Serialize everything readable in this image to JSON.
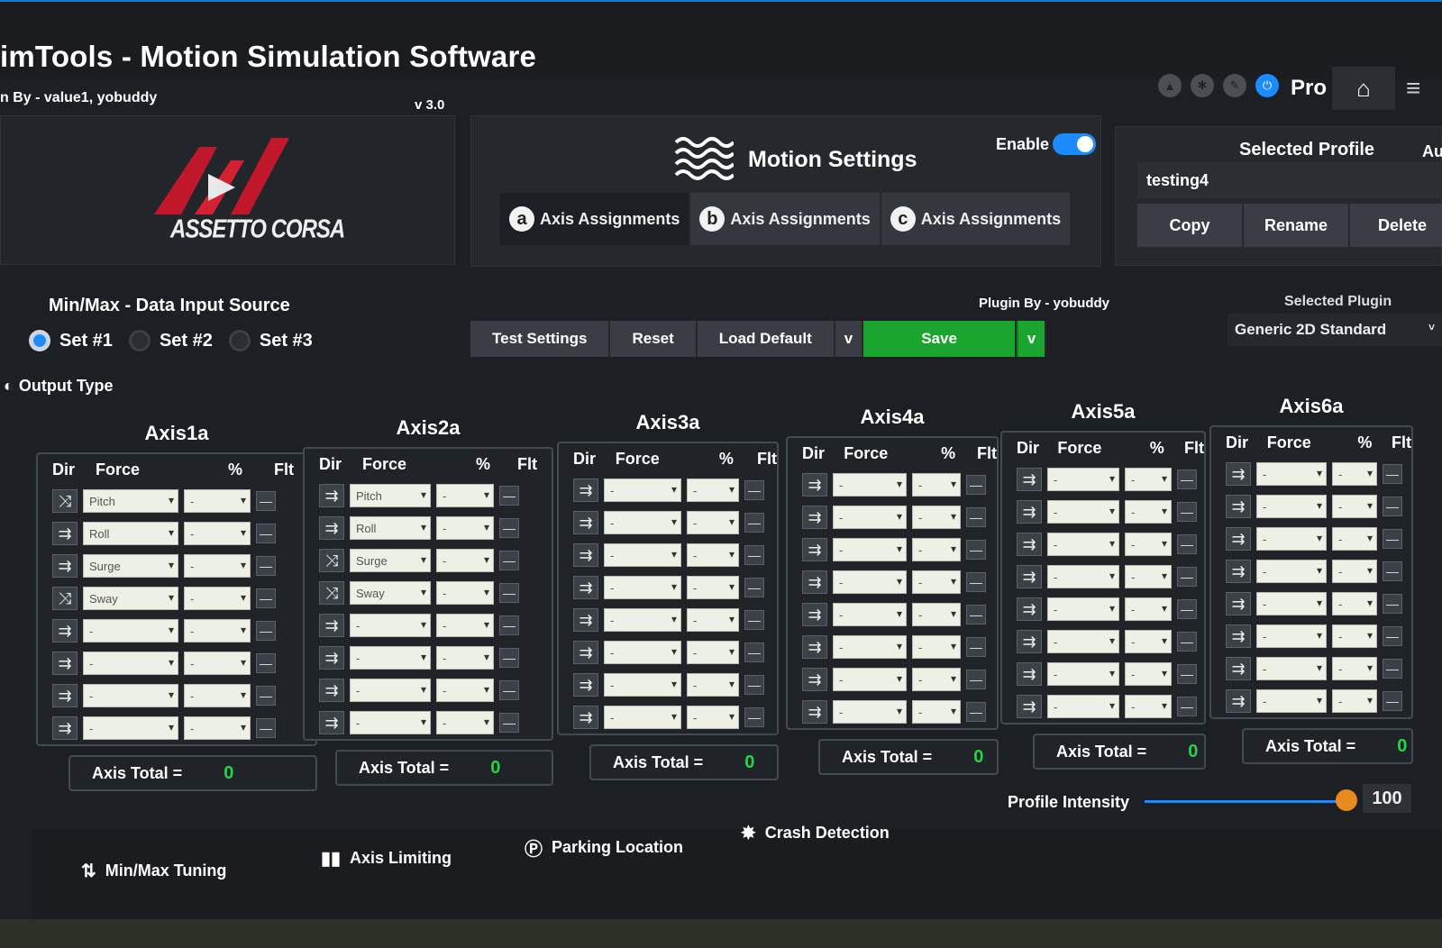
{
  "app": {
    "title": "imTools - Motion Simulation Software",
    "credits": "n By - value1, yobuddy",
    "version": "v 3.0",
    "edition": "Pro",
    "logo_text": "ASSETTO CORSA"
  },
  "motion": {
    "title": "Motion Settings",
    "enable_label": "Enable",
    "enable_on": true,
    "tabs": [
      {
        "badge": "a",
        "label": "Axis Assignments"
      },
      {
        "badge": "b",
        "label": "Axis Assignments"
      },
      {
        "badge": "c",
        "label": "Axis Assignments"
      }
    ]
  },
  "profile": {
    "label": "Selected Profile",
    "auto_label": "Au",
    "value": "testing4",
    "buttons": [
      "Copy",
      "Rename",
      "Delete"
    ]
  },
  "input_source": {
    "label": "Min/Max - Data Input Source",
    "options": [
      "Set #1",
      "Set #2",
      "Set #3"
    ],
    "selected": "Set #1"
  },
  "output_type_label": "Output Type",
  "actions": {
    "test": "Test Settings",
    "reset": "Reset",
    "load_default": "Load Default",
    "dropdown": "v",
    "save": "Save"
  },
  "plugin": {
    "by": "Plugin By - yobuddy",
    "label": "Selected Plugin",
    "value": "Generic 2D Standard"
  },
  "table_headers": {
    "dir": "Dir",
    "force": "Force",
    "pct": "%",
    "flt": "Flt"
  },
  "total_label": "Axis Total =",
  "axes": [
    {
      "name": "Axis1a",
      "total": "0",
      "rows": [
        {
          "dir": "swap",
          "force": "Pitch",
          "pct": "-"
        },
        {
          "dir": "arrow",
          "force": "Roll",
          "pct": "-"
        },
        {
          "dir": "arrow",
          "force": "Surge",
          "pct": "-"
        },
        {
          "dir": "swap",
          "force": "Sway",
          "pct": "-"
        },
        {
          "dir": "arrow",
          "force": "-",
          "pct": "-"
        },
        {
          "dir": "arrow",
          "force": "-",
          "pct": "-"
        },
        {
          "dir": "arrow",
          "force": "-",
          "pct": "-"
        },
        {
          "dir": "arrow",
          "force": "-",
          "pct": "-"
        }
      ]
    },
    {
      "name": "Axis2a",
      "total": "0",
      "rows": [
        {
          "dir": "arrow",
          "force": "Pitch",
          "pct": "-"
        },
        {
          "dir": "arrow",
          "force": "Roll",
          "pct": "-"
        },
        {
          "dir": "swap",
          "force": "Surge",
          "pct": "-"
        },
        {
          "dir": "swap",
          "force": "Sway",
          "pct": "-"
        },
        {
          "dir": "arrow",
          "force": "-",
          "pct": "-"
        },
        {
          "dir": "arrow",
          "force": "-",
          "pct": "-"
        },
        {
          "dir": "arrow",
          "force": "-",
          "pct": "-"
        },
        {
          "dir": "arrow",
          "force": "-",
          "pct": "-"
        }
      ]
    },
    {
      "name": "Axis3a",
      "total": "0",
      "rows": [
        {
          "dir": "arrow",
          "force": "-",
          "pct": "-"
        },
        {
          "dir": "arrow",
          "force": "-",
          "pct": "-"
        },
        {
          "dir": "arrow",
          "force": "-",
          "pct": "-"
        },
        {
          "dir": "arrow",
          "force": "-",
          "pct": "-"
        },
        {
          "dir": "arrow",
          "force": "-",
          "pct": "-"
        },
        {
          "dir": "arrow",
          "force": "-",
          "pct": "-"
        },
        {
          "dir": "arrow",
          "force": "-",
          "pct": "-"
        },
        {
          "dir": "arrow",
          "force": "-",
          "pct": "-"
        }
      ]
    },
    {
      "name": "Axis4a",
      "total": "0",
      "rows": [
        {
          "dir": "arrow",
          "force": "-",
          "pct": "-"
        },
        {
          "dir": "arrow",
          "force": "-",
          "pct": "-"
        },
        {
          "dir": "arrow",
          "force": "-",
          "pct": "-"
        },
        {
          "dir": "arrow",
          "force": "-",
          "pct": "-"
        },
        {
          "dir": "arrow",
          "force": "-",
          "pct": "-"
        },
        {
          "dir": "arrow",
          "force": "-",
          "pct": "-"
        },
        {
          "dir": "arrow",
          "force": "-",
          "pct": "-"
        },
        {
          "dir": "arrow",
          "force": "-",
          "pct": "-"
        }
      ]
    },
    {
      "name": "Axis5a",
      "total": "0",
      "rows": [
        {
          "dir": "arrow",
          "force": "-",
          "pct": "-"
        },
        {
          "dir": "arrow",
          "force": "-",
          "pct": "-"
        },
        {
          "dir": "arrow",
          "force": "-",
          "pct": "-"
        },
        {
          "dir": "arrow",
          "force": "-",
          "pct": "-"
        },
        {
          "dir": "arrow",
          "force": "-",
          "pct": "-"
        },
        {
          "dir": "arrow",
          "force": "-",
          "pct": "-"
        },
        {
          "dir": "arrow",
          "force": "-",
          "pct": "-"
        },
        {
          "dir": "arrow",
          "force": "-",
          "pct": "-"
        }
      ]
    },
    {
      "name": "Axis6a",
      "total": "0",
      "rows": [
        {
          "dir": "arrow",
          "force": "-",
          "pct": "-"
        },
        {
          "dir": "arrow",
          "force": "-",
          "pct": "-"
        },
        {
          "dir": "arrow",
          "force": "-",
          "pct": "-"
        },
        {
          "dir": "arrow",
          "force": "-",
          "pct": "-"
        },
        {
          "dir": "arrow",
          "force": "-",
          "pct": "-"
        },
        {
          "dir": "arrow",
          "force": "-",
          "pct": "-"
        },
        {
          "dir": "arrow",
          "force": "-",
          "pct": "-"
        },
        {
          "dir": "arrow",
          "force": "-",
          "pct": "-"
        }
      ]
    }
  ],
  "intensity": {
    "label": "Profile Intensity",
    "value": "100",
    "level": 1.0
  },
  "bottom_nav": [
    {
      "icon": "up-down-arrows-icon",
      "label": "Min/Max Tuning"
    },
    {
      "icon": "bars-icon",
      "label": "Axis Limiting"
    },
    {
      "icon": "parking-icon",
      "label": "Parking Location"
    },
    {
      "icon": "crash-burst-icon",
      "label": "Crash Detection"
    }
  ],
  "colors": {
    "accent": "#1a8cff",
    "save": "#1aa52e",
    "total_value": "#27d445",
    "knob": "#e88a1c"
  }
}
